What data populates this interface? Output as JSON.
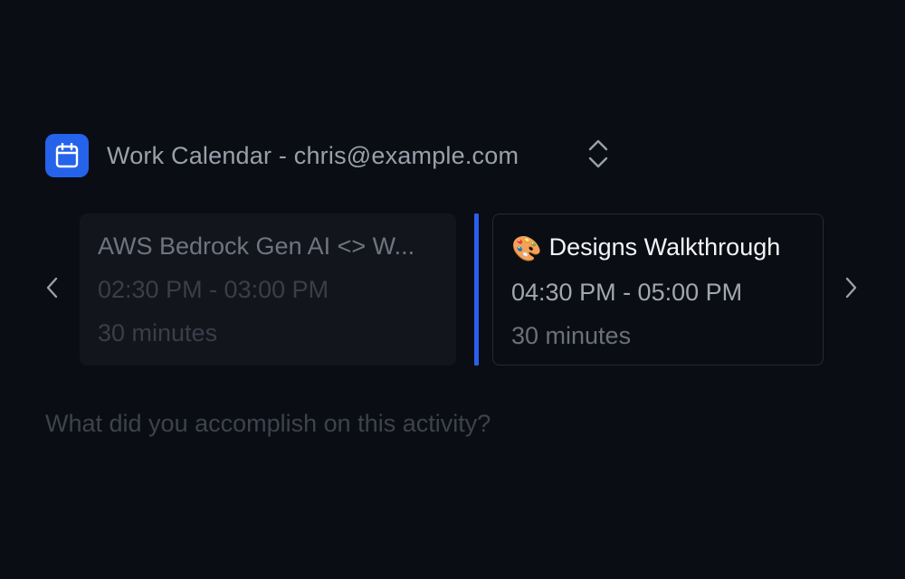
{
  "calendar": {
    "title": "Work Calendar - chris@example.com",
    "icon": "calendar-icon",
    "accent_color": "#2563eb"
  },
  "events": [
    {
      "title": "AWS Bedrock Gen AI <> W...",
      "time": "02:30 PM - 03:00 PM",
      "duration": "30 minutes",
      "state": "past"
    },
    {
      "emoji": "🎨",
      "title": "Designs Walkthrough",
      "time": "04:30 PM - 05:00 PM",
      "duration": "30 minutes",
      "state": "current"
    }
  ],
  "now_indicator_color": "#2a5ff0",
  "navigation": {
    "prev_icon": "chevron-left-icon",
    "next_icon": "chevron-right-icon",
    "switch_icon": "chevron-up-down-icon"
  },
  "activity_input": {
    "placeholder": "What did you accomplish on this activity?",
    "value": ""
  }
}
